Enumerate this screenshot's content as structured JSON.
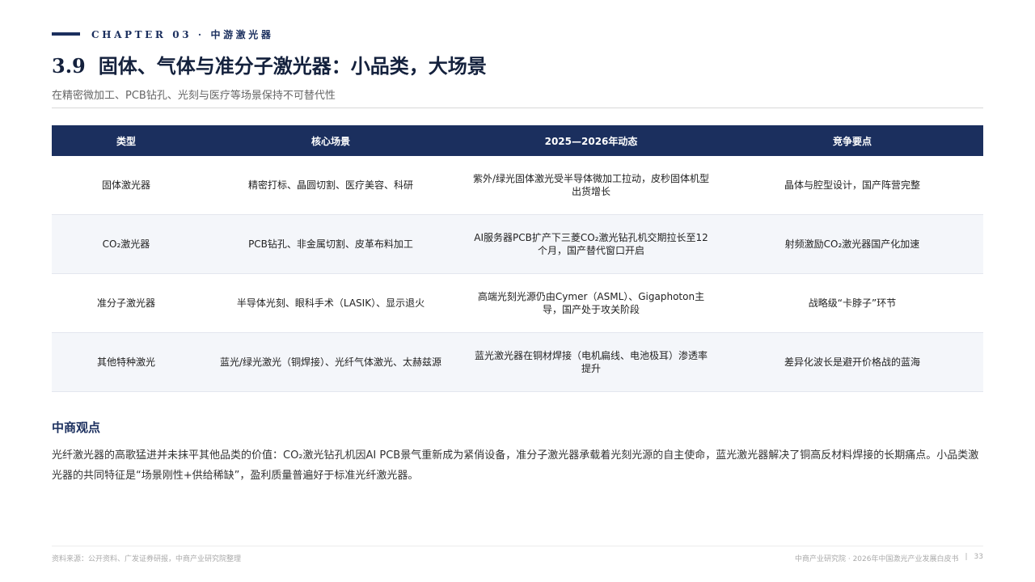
{
  "header": {
    "chapter": "CHAPTER 03 · 中游激光器",
    "section_number": "3.9",
    "title": "固体、气体与准分子激光器：小品类，大场景",
    "subtitle": "在精密微加工、PCB钻孔、光刻与医疗等场景保持不可替代性"
  },
  "table": {
    "columns": [
      "类型",
      "核心场景",
      "2025—2026年动态",
      "竞争要点"
    ],
    "rows": [
      [
        "固体激光器",
        "精密打标、晶圆切割、医疗美容、科研",
        "紫外/绿光固体激光受半导体微加工拉动，皮秒固体机型出货增长",
        "晶体与腔型设计，国产阵营完整"
      ],
      [
        "CO₂激光器",
        "PCB钻孔、非金属切割、皮革布料加工",
        "AI服务器PCB扩产下三菱CO₂激光钻孔机交期拉长至12个月，国产替代窗口开启",
        "射频激励CO₂激光器国产化加速"
      ],
      [
        "准分子激光器",
        "半导体光刻、眼科手术（LASIK）、显示退火",
        "高端光刻光源仍由Cymer（ASML）、Gigaphoton主导，国产处于攻关阶段",
        "战略级“卡脖子”环节"
      ],
      [
        "其他特种激光",
        "蓝光/绿光激光（铜焊接）、光纤气体激光、太赫兹源",
        "蓝光激光器在铜材焊接（电机扁线、电池极耳）渗透率提升",
        "差异化波长是避开价格战的蓝海"
      ]
    ]
  },
  "insight": {
    "heading": "中商观点",
    "text": "光纤激光器的高歌猛进并未抹平其他品类的价值：CO₂激光钻孔机因AI PCB景气重新成为紧俏设备，准分子激光器承载着光刻光源的自主使命，蓝光激光器解决了铜高反材料焊接的长期痛点。小品类激光器的共同特征是“场景刚性+供给稀缺”，盈利质量普遍好于标准光纤激光器。"
  },
  "footer": {
    "source": "资料来源：公开资料、广发证券研报，中商产业研究院整理",
    "publication": "中商产业研究院 · 2026年中国激光产业发展白皮书",
    "separator": "|",
    "page": "33"
  }
}
